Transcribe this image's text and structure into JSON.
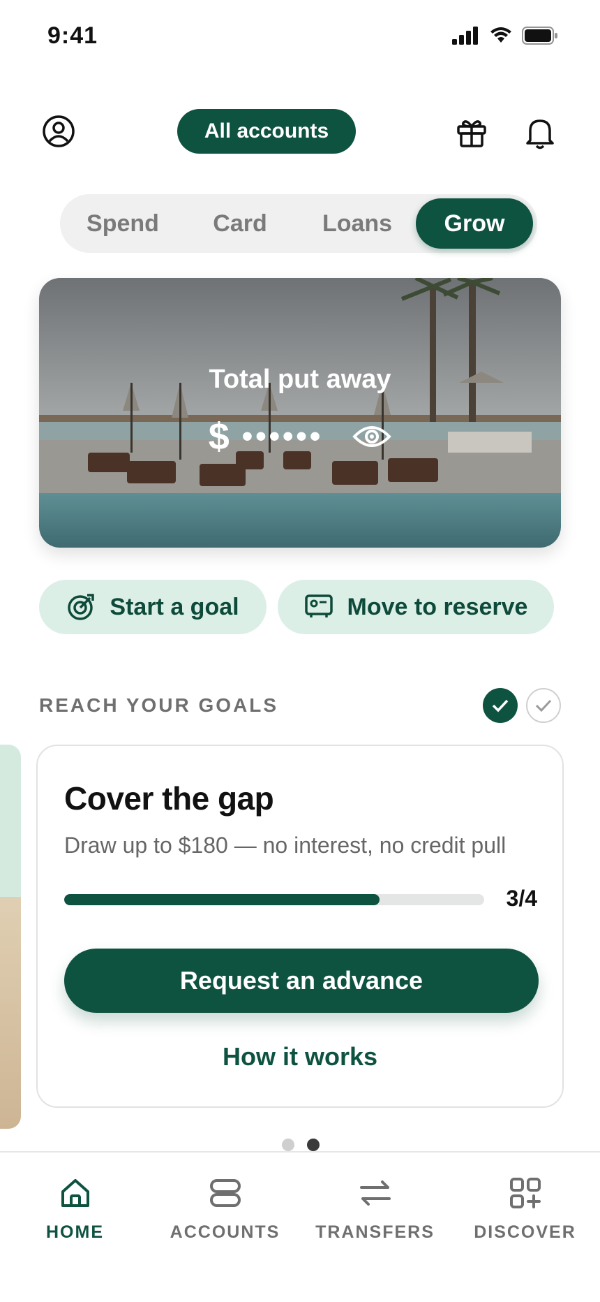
{
  "status_bar": {
    "time": "9:41"
  },
  "header": {
    "profile_icon": "user-circle-icon",
    "accounts_label": "All accounts",
    "gift_icon": "gift-icon",
    "bell_icon": "bell-icon"
  },
  "tabs": [
    {
      "label": "Spend",
      "active": false
    },
    {
      "label": "Card",
      "active": false
    },
    {
      "label": "Loans",
      "active": false
    },
    {
      "label": "Grow",
      "active": true
    }
  ],
  "hero": {
    "title": "Total put away",
    "currency": "$",
    "masked_amount": "••••••",
    "eye_icon": "eye-icon"
  },
  "actions": [
    {
      "label": "Start a goal",
      "icon": "target-icon"
    },
    {
      "label": "Move to reserve",
      "icon": "reserve-icon"
    }
  ],
  "goals": {
    "section_title": "REACH YOUR GOALS",
    "card": {
      "title": "Cover the gap",
      "subtitle": "Draw up to $180 — no interest, no credit pull",
      "progress": 0.75,
      "progress_label": "3/4",
      "primary_button": "Request an advance",
      "secondary_link": "How it works"
    }
  },
  "nav": [
    {
      "label": "HOME",
      "icon": "home-icon",
      "active": true
    },
    {
      "label": "ACCOUNTS",
      "icon": "accounts-icon",
      "active": false
    },
    {
      "label": "TRANSFERS",
      "icon": "transfer-icon",
      "active": false
    },
    {
      "label": "DISCOVER",
      "icon": "discover-icon",
      "active": false
    }
  ],
  "colors": {
    "brand": "#0e5240",
    "chip_bg": "#dcefe6",
    "muted_text": "#6f6f6f"
  }
}
